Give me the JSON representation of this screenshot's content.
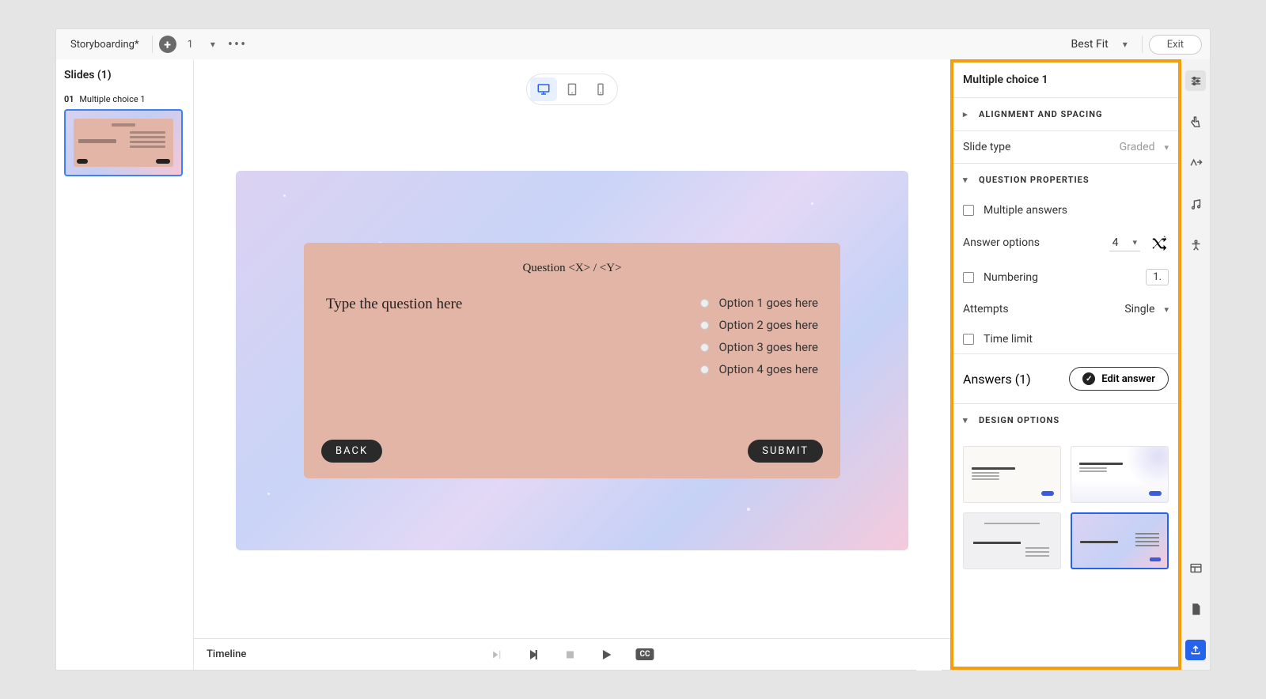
{
  "toolbar": {
    "project_name": "Storyboarding*",
    "page_number": "1",
    "zoom": "Best Fit",
    "exit": "Exit"
  },
  "slides_panel": {
    "header": "Slides (1)",
    "items": [
      {
        "num": "01",
        "title": "Multiple choice 1"
      }
    ]
  },
  "slide": {
    "counter": "Question <X> / <Y>",
    "question": "Type the question here",
    "options": [
      "Option  1 goes here",
      "Option  2 goes here",
      "Option  3 goes here",
      "Option  4 goes here"
    ],
    "back": "BACK",
    "submit": "SUBMIT"
  },
  "timeline": {
    "label": "Timeline"
  },
  "props": {
    "title": "Multiple choice 1",
    "alignment_header": "ALIGNMENT AND SPACING",
    "slide_type_label": "Slide type",
    "slide_type_value": "Graded",
    "question_props_header": "QUESTION PROPERTIES",
    "multiple_answers": "Multiple answers",
    "answer_options_label": "Answer options",
    "answer_options_value": "4",
    "numbering_label": "Numbering",
    "numbering_value": "1.",
    "attempts_label": "Attempts",
    "attempts_value": "Single",
    "time_limit": "Time limit",
    "answers_label": "Answers (1)",
    "edit_answer": "Edit answer",
    "design_options_header": "DESIGN OPTIONS"
  }
}
